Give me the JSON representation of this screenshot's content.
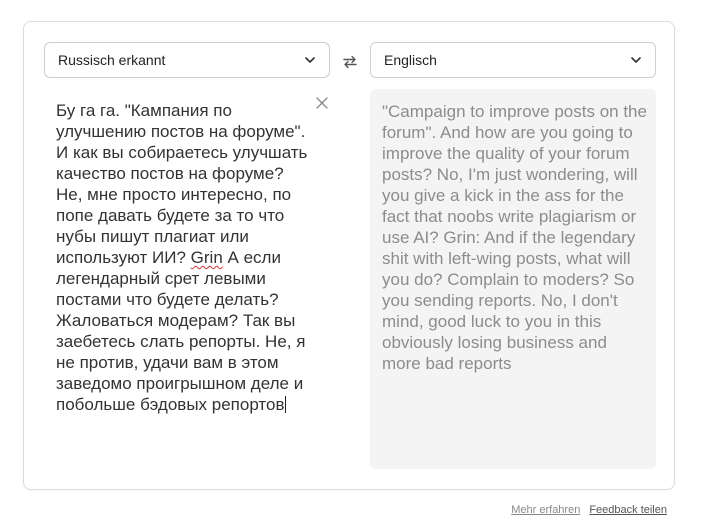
{
  "source_language": {
    "label": "Russisch erkannt"
  },
  "target_language": {
    "label": "Englisch"
  },
  "icons": {
    "swap": "swap-arrows-icon",
    "clear": "close-icon",
    "dropdown": "chevron-down-icon"
  },
  "source_text": {
    "before_misspelled": "Бу га га. \"Кампания по улучшению постов на форуме\". И как вы собираетесь улучшать качество постов на форуме? Не, мне просто интересно, по попе давать будете за то что нубы пишут плагиат или используют ИИ? ",
    "misspelled": "Grin",
    "after_misspelled": " А если легендарный срет левыми постами что будете делать? Жаловаться модерам? Так вы заебетесь слать репорты. Не, я не против, удачи вам в этом заведомо проигрышном деле и побольше бэдовых репортов"
  },
  "translation_text": "\"Campaign to improve posts on the forum\". And how are you going to improve the quality of your forum posts? No, I'm just wondering, will you give a kick in the ass for the fact that noobs write plagiarism or use AI? Grin: And if the legendary shit with left-wing posts, what will you do? Complain to moders? So you sending reports. No, I don't mind, good luck to you in this obviously losing business and more bad reports",
  "footer": {
    "learn_more": "Mehr erfahren",
    "feedback": "Feedback teilen"
  },
  "colors": {
    "card_border": "#dcdcdc",
    "target_background": "#f4f4f4",
    "translation_text": "#8c8c8c",
    "source_text": "#333333"
  }
}
